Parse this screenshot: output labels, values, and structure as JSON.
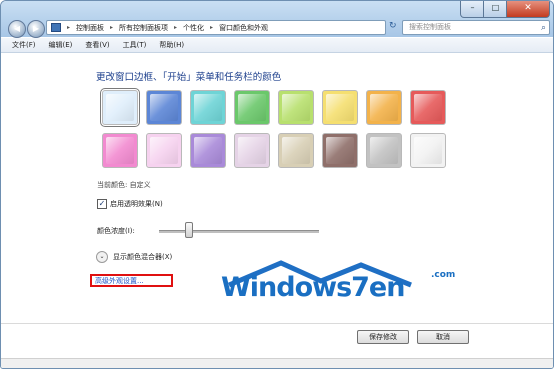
{
  "address": {
    "crumbs": [
      "控制面板",
      "所有控制面板项",
      "个性化",
      "窗口颜色和外观"
    ]
  },
  "search": {
    "placeholder": "搜索控制面板"
  },
  "menu": [
    "文件(F)",
    "编辑(E)",
    "查看(V)",
    "工具(T)",
    "帮助(H)"
  ],
  "main": {
    "heading": "更改窗口边框、「开始」菜单和任务栏的颜色",
    "current_color": "当前颜色: 自定义",
    "transparency_label": "启用透明效果(N)",
    "transparency_checked": true,
    "intensity_label": "颜色浓度(I):",
    "intensity_value": 0.18,
    "mixer_label": "显示颜色混合器(X)",
    "advanced_link": "高级外观设置..."
  },
  "swatch_colors": [
    "#dfeefb",
    "#5c86d6",
    "#6ed4d6",
    "#6bc86b",
    "#b8e06e",
    "#f5df70",
    "#f3b24a",
    "#e65a5a",
    "#f28ad0",
    "#f6d2ef",
    "#a98ad9",
    "#e5d3e6",
    "#d8cfb5",
    "#8f6f6a",
    "#c2c2c2",
    "#f2f2f2"
  ],
  "watermark": {
    "word": "Windows7en",
    "tld": ".com"
  },
  "buttons": {
    "save": "保存修改",
    "cancel": "取消"
  },
  "colors": {
    "heading": "#1c3f8c",
    "highlight_box": "#e01010",
    "link": "#1a4fc4"
  }
}
